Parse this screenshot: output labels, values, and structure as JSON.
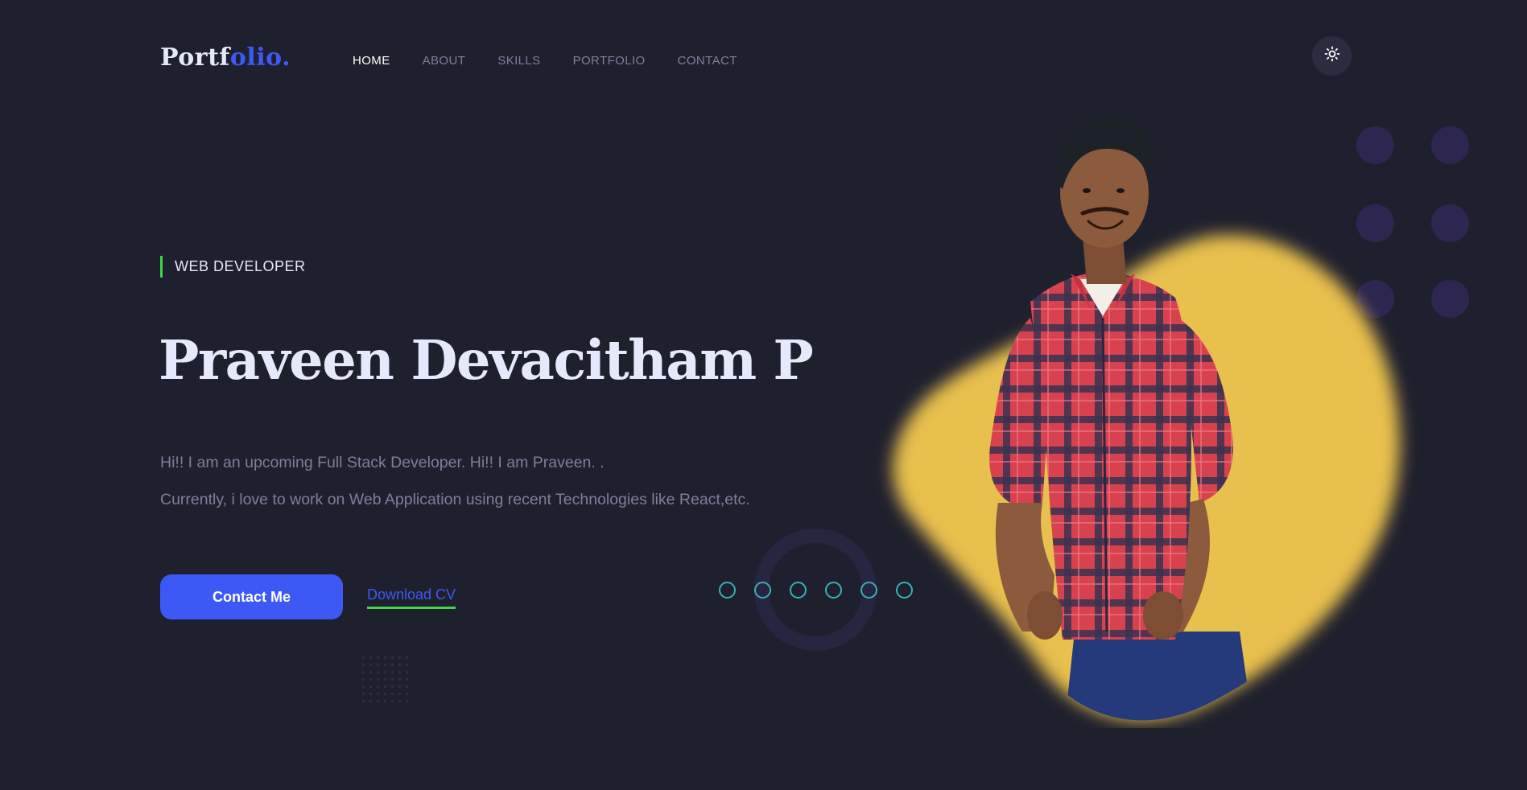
{
  "header": {
    "logo_main": "Portf",
    "logo_accent": "olio.",
    "nav": [
      {
        "label": "HOME",
        "active": true
      },
      {
        "label": "ABOUT",
        "active": false
      },
      {
        "label": "SKILLS",
        "active": false
      },
      {
        "label": "PORTFOLIO",
        "active": false
      },
      {
        "label": "CONTACT",
        "active": false
      }
    ],
    "theme_toggle_icon": "sun-icon"
  },
  "hero": {
    "role": "WEB DEVELOPER",
    "name": "Praveen Devacitham P",
    "intro_line1": "Hi!! I am an upcoming Full Stack Developer. Hi!! I am Praveen. .",
    "intro_line2": "Currently, i love to work on Web Application using recent Technologies like React,etc.",
    "contact_button": "Contact Me",
    "download_link": "Download CV",
    "photo_icon": "profile-photo"
  },
  "colors": {
    "background": "#1f202e",
    "accent_blue": "#3d59f5",
    "accent_green": "#3fd648",
    "blob_yellow": "#e8c04e",
    "text_light": "#e6e8fb",
    "text_muted": "#7d7f99",
    "teal_rings": "#35b2b7",
    "purple_dots": "#2c2650"
  }
}
